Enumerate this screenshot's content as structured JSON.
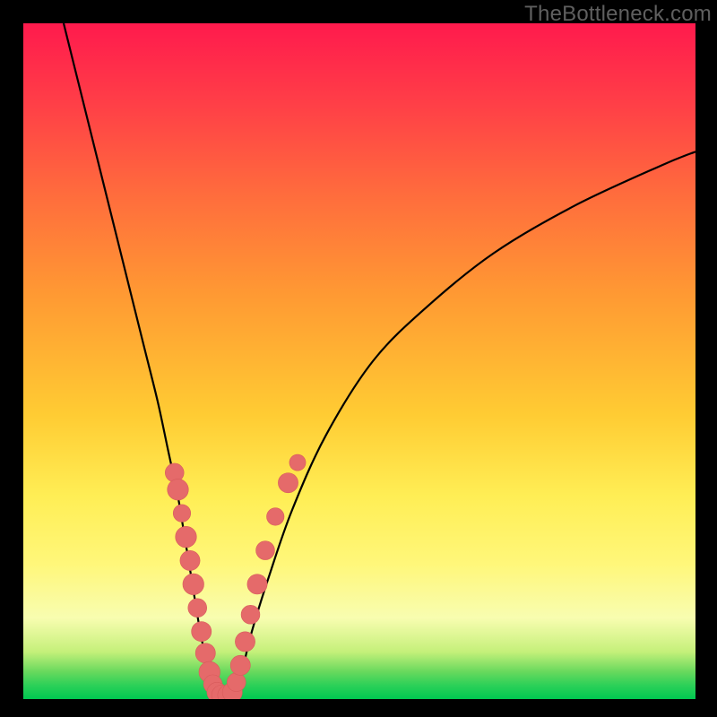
{
  "watermark": "TheBottleneck.com",
  "colors": {
    "curve": "#000000",
    "marker_fill": "#e56a6a",
    "marker_stroke": "#d85c5c",
    "gradient_top": "#ff1a4d",
    "gradient_bottom": "#00c851"
  },
  "chart_data": {
    "type": "line",
    "title": "",
    "xlabel": "",
    "ylabel": "",
    "xlim": [
      0,
      100
    ],
    "ylim": [
      0,
      100
    ],
    "grid": false,
    "legend": false,
    "annotations": [
      "TheBottleneck.com"
    ],
    "series": [
      {
        "name": "left_branch",
        "x": [
          6.0,
          8.5,
          11.0,
          13.5,
          16.0,
          18.0,
          20.0,
          21.5,
          23.0,
          24.0,
          25.0,
          25.8,
          26.5,
          27.2,
          27.8,
          28.3,
          28.6
        ],
        "y": [
          100,
          90,
          80,
          70,
          60,
          52,
          44,
          37,
          30,
          24,
          18,
          13,
          9,
          6,
          3.5,
          1.5,
          0.5
        ]
      },
      {
        "name": "valley_floor",
        "x": [
          28.6,
          31.3
        ],
        "y": [
          0.5,
          0.5
        ]
      },
      {
        "name": "right_branch",
        "x": [
          31.3,
          32.5,
          34.0,
          36.5,
          40.0,
          45.0,
          52.0,
          60.0,
          70.0,
          82.0,
          95.0,
          100.0
        ],
        "y": [
          0.5,
          4,
          10,
          18,
          28,
          39,
          50,
          58,
          66,
          73,
          79,
          81
        ]
      }
    ],
    "markers": [
      {
        "x": 22.5,
        "y": 33.5,
        "r": 1.1
      },
      {
        "x": 23.0,
        "y": 31.0,
        "r": 1.3
      },
      {
        "x": 23.6,
        "y": 27.5,
        "r": 1.0
      },
      {
        "x": 24.2,
        "y": 24.0,
        "r": 1.3
      },
      {
        "x": 24.8,
        "y": 20.5,
        "r": 1.2
      },
      {
        "x": 25.3,
        "y": 17.0,
        "r": 1.3
      },
      {
        "x": 25.9,
        "y": 13.5,
        "r": 1.1
      },
      {
        "x": 26.5,
        "y": 10.0,
        "r": 1.2
      },
      {
        "x": 27.1,
        "y": 6.8,
        "r": 1.2
      },
      {
        "x": 27.7,
        "y": 4.0,
        "r": 1.3
      },
      {
        "x": 28.2,
        "y": 2.2,
        "r": 1.1
      },
      {
        "x": 28.8,
        "y": 1.0,
        "r": 1.2
      },
      {
        "x": 29.5,
        "y": 0.6,
        "r": 1.2
      },
      {
        "x": 30.4,
        "y": 0.6,
        "r": 1.2
      },
      {
        "x": 31.1,
        "y": 1.0,
        "r": 1.2
      },
      {
        "x": 31.7,
        "y": 2.5,
        "r": 1.1
      },
      {
        "x": 32.3,
        "y": 5.0,
        "r": 1.2
      },
      {
        "x": 33.0,
        "y": 8.5,
        "r": 1.2
      },
      {
        "x": 33.8,
        "y": 12.5,
        "r": 1.1
      },
      {
        "x": 34.8,
        "y": 17.0,
        "r": 1.2
      },
      {
        "x": 36.0,
        "y": 22.0,
        "r": 1.1
      },
      {
        "x": 37.5,
        "y": 27.0,
        "r": 1.0
      },
      {
        "x": 39.4,
        "y": 32.0,
        "r": 1.2
      },
      {
        "x": 40.8,
        "y": 35.0,
        "r": 0.9
      }
    ]
  }
}
